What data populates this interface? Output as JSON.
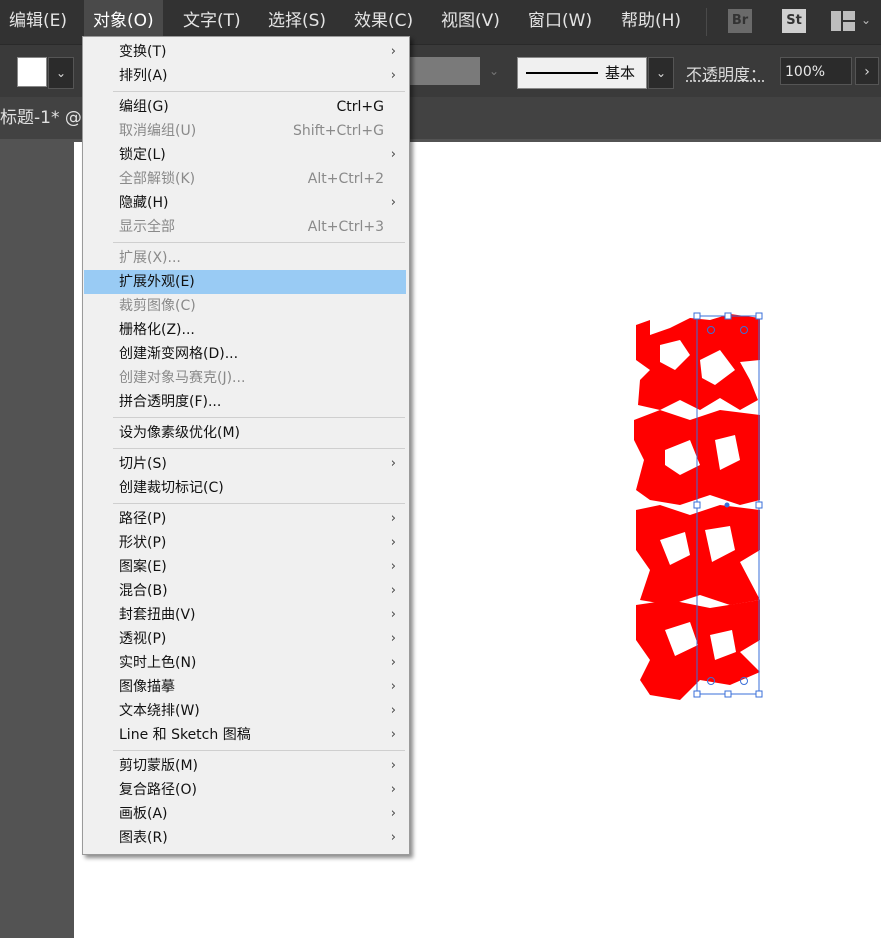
{
  "menubar": {
    "items": [
      "编辑(E)",
      "对象(O)",
      "文字(T)",
      "选择(S)",
      "效果(C)",
      "视图(V)",
      "窗口(W)",
      "帮助(H)"
    ],
    "bridge_label": "Br",
    "stock_label": "St",
    "icons": [
      "bridge-icon",
      "stock-icon",
      "workspace-switcher-icon"
    ]
  },
  "controlbar": {
    "stroke_profile": "基本",
    "opacity_label": "不透明度：",
    "opacity_value": "100%"
  },
  "tabbar": {
    "doc_title": "标题-1* @"
  },
  "object_menu": {
    "items": [
      {
        "label": "变换(T)",
        "shortcut": "",
        "enabled": true,
        "submenu": true
      },
      {
        "label": "排列(A)",
        "shortcut": "",
        "enabled": true,
        "submenu": true
      },
      {
        "label": "编组(G)",
        "shortcut": "Ctrl+G",
        "enabled": true,
        "submenu": false
      },
      {
        "label": "取消编组(U)",
        "shortcut": "Shift+Ctrl+G",
        "enabled": false,
        "submenu": false
      },
      {
        "label": "锁定(L)",
        "shortcut": "",
        "enabled": true,
        "submenu": true
      },
      {
        "label": "全部解锁(K)",
        "shortcut": "Alt+Ctrl+2",
        "enabled": false,
        "submenu": false
      },
      {
        "label": "隐藏(H)",
        "shortcut": "",
        "enabled": true,
        "submenu": true
      },
      {
        "label": "显示全部",
        "shortcut": "Alt+Ctrl+3",
        "enabled": false,
        "submenu": false
      },
      {
        "label": "扩展(X)...",
        "shortcut": "",
        "enabled": false,
        "submenu": false
      },
      {
        "label": "扩展外观(E)",
        "shortcut": "",
        "enabled": true,
        "submenu": false,
        "highlighted": true
      },
      {
        "label": "裁剪图像(C)",
        "shortcut": "",
        "enabled": false,
        "submenu": false
      },
      {
        "label": "栅格化(Z)...",
        "shortcut": "",
        "enabled": true,
        "submenu": false
      },
      {
        "label": "创建渐变网格(D)...",
        "shortcut": "",
        "enabled": true,
        "submenu": false
      },
      {
        "label": "创建对象马赛克(J)...",
        "shortcut": "",
        "enabled": false,
        "submenu": false
      },
      {
        "label": "拼合透明度(F)...",
        "shortcut": "",
        "enabled": true,
        "submenu": false
      },
      {
        "label": "设为像素级优化(M)",
        "shortcut": "",
        "enabled": true,
        "submenu": false
      },
      {
        "label": "切片(S)",
        "shortcut": "",
        "enabled": true,
        "submenu": true
      },
      {
        "label": "创建裁切标记(C)",
        "shortcut": "",
        "enabled": true,
        "submenu": false
      },
      {
        "label": "路径(P)",
        "shortcut": "",
        "enabled": true,
        "submenu": true
      },
      {
        "label": "形状(P)",
        "shortcut": "",
        "enabled": true,
        "submenu": true
      },
      {
        "label": "图案(E)",
        "shortcut": "",
        "enabled": true,
        "submenu": true
      },
      {
        "label": "混合(B)",
        "shortcut": "",
        "enabled": true,
        "submenu": true
      },
      {
        "label": "封套扭曲(V)",
        "shortcut": "",
        "enabled": true,
        "submenu": true
      },
      {
        "label": "透视(P)",
        "shortcut": "",
        "enabled": true,
        "submenu": true
      },
      {
        "label": "实时上色(N)",
        "shortcut": "",
        "enabled": true,
        "submenu": true
      },
      {
        "label": "图像描摹",
        "shortcut": "",
        "enabled": true,
        "submenu": true
      },
      {
        "label": "文本绕排(W)",
        "shortcut": "",
        "enabled": true,
        "submenu": true
      },
      {
        "label": "Line 和 Sketch 图稿",
        "shortcut": "",
        "enabled": true,
        "submenu": true
      },
      {
        "label": "剪切蒙版(M)",
        "shortcut": "",
        "enabled": true,
        "submenu": true
      },
      {
        "label": "复合路径(O)",
        "shortcut": "",
        "enabled": true,
        "submenu": true
      },
      {
        "label": "画板(A)",
        "shortcut": "",
        "enabled": true,
        "submenu": true
      },
      {
        "label": "图表(R)",
        "shortcut": "",
        "enabled": true,
        "submenu": true
      }
    ]
  },
  "colors": {
    "artwork_red": "#ff0000",
    "selection_blue": "#3a6fd8",
    "menu_highlight": "#99cbf4"
  }
}
